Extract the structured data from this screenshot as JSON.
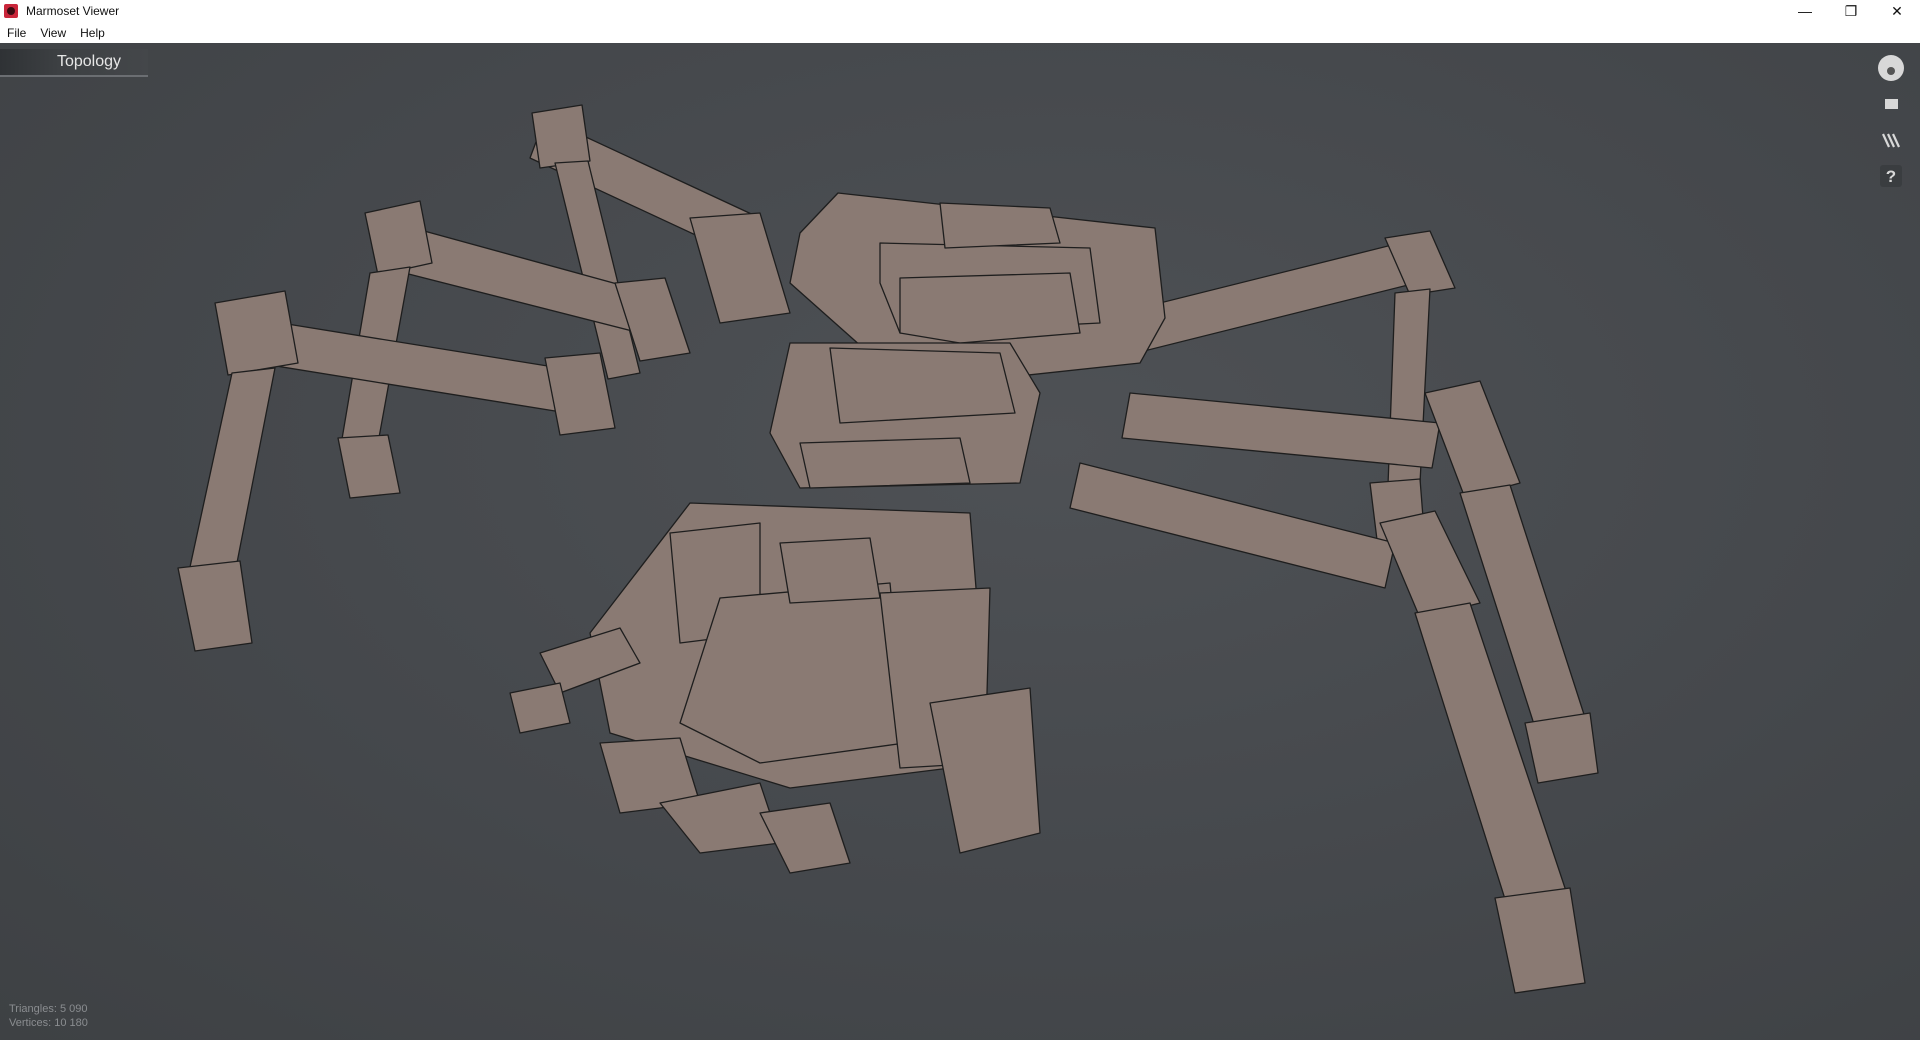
{
  "window": {
    "title": "Marmoset Viewer"
  },
  "window_controls": {
    "minimize": "—",
    "restore": "❐",
    "close": "✕"
  },
  "menu": {
    "items": [
      "File",
      "View",
      "Help"
    ]
  },
  "viewport": {
    "tab_label": "Topology",
    "side_icons": [
      "avatar-icon",
      "screen-icon",
      "wireframe-icon",
      "help-icon"
    ],
    "help_glyph": "?",
    "stats": {
      "triangles": "Triangles: 5 090",
      "vertices": "Vertices: 10 180"
    }
  },
  "colors": {
    "viewport_bg": "#46494c",
    "model_face": "#8a7a73",
    "model_outline": "#1e1e1e",
    "app_icon": "#c9263a"
  }
}
